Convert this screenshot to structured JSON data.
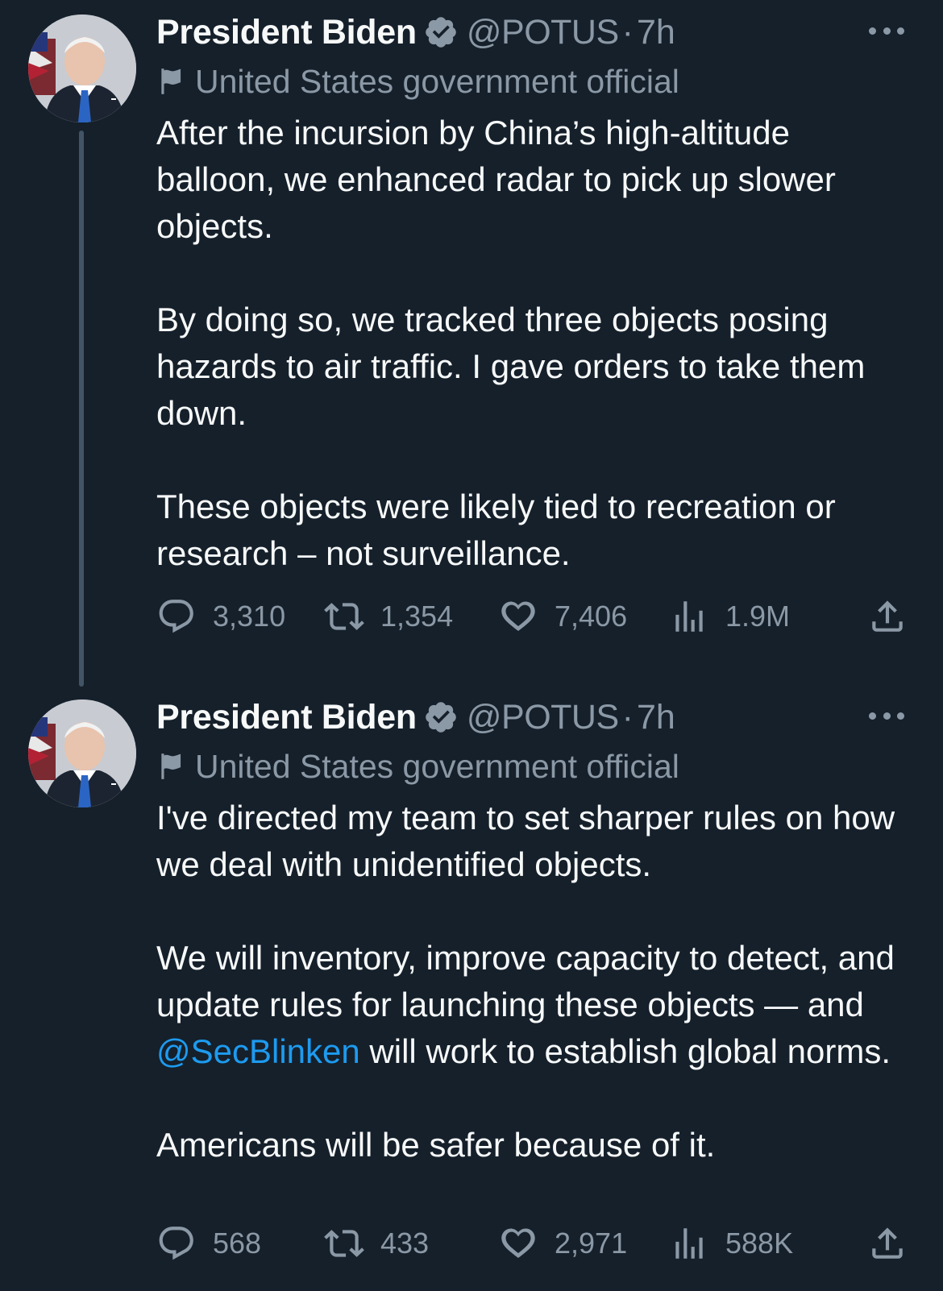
{
  "tweets": [
    {
      "author_name": "President Biden",
      "handle": "@POTUS",
      "separator": "·",
      "time": "7h",
      "account_label": "United States government official",
      "paragraphs": [
        "After the incursion by China’s high-altitude balloon, we enhanced radar to pick up slower objects.",
        "By doing so, we tracked three objects posing hazards to air traffic. I gave orders to take them down.",
        "These objects were likely tied to recreation or research – not surveillance."
      ],
      "replies": "3,310",
      "retweets": "1,354",
      "likes": "7,406",
      "views": "1.9M"
    },
    {
      "author_name": "President Biden",
      "handle": "@POTUS",
      "separator": "·",
      "time": "7h",
      "account_label": "United States government official",
      "paragraphs": [
        "I've directed my team to set sharper rules on how we deal with unidentified objects."
      ],
      "p2_before": "We will inventory, improve capacity to detect, and update rules for launching these objects — and ",
      "p2_mention": "@SecBlinken",
      "p2_after": " will work to establish global norms.",
      "p3": "Americans will be safer because of it.",
      "replies": "568",
      "retweets": "433",
      "likes": "2,971",
      "views": "588K"
    }
  ],
  "icons": {
    "verified": "verified-badge-icon",
    "label": "government-flag-icon",
    "reply": "reply-icon",
    "retweet": "retweet-icon",
    "like": "heart-icon",
    "views": "views-chart-icon",
    "share": "share-icon",
    "more": "more-icon"
  },
  "colors": {
    "background": "#15202b",
    "text_primary": "#f7f9f9",
    "text_secondary": "#8b98a5",
    "link": "#1d9bf0",
    "thread_line": "#425466"
  }
}
